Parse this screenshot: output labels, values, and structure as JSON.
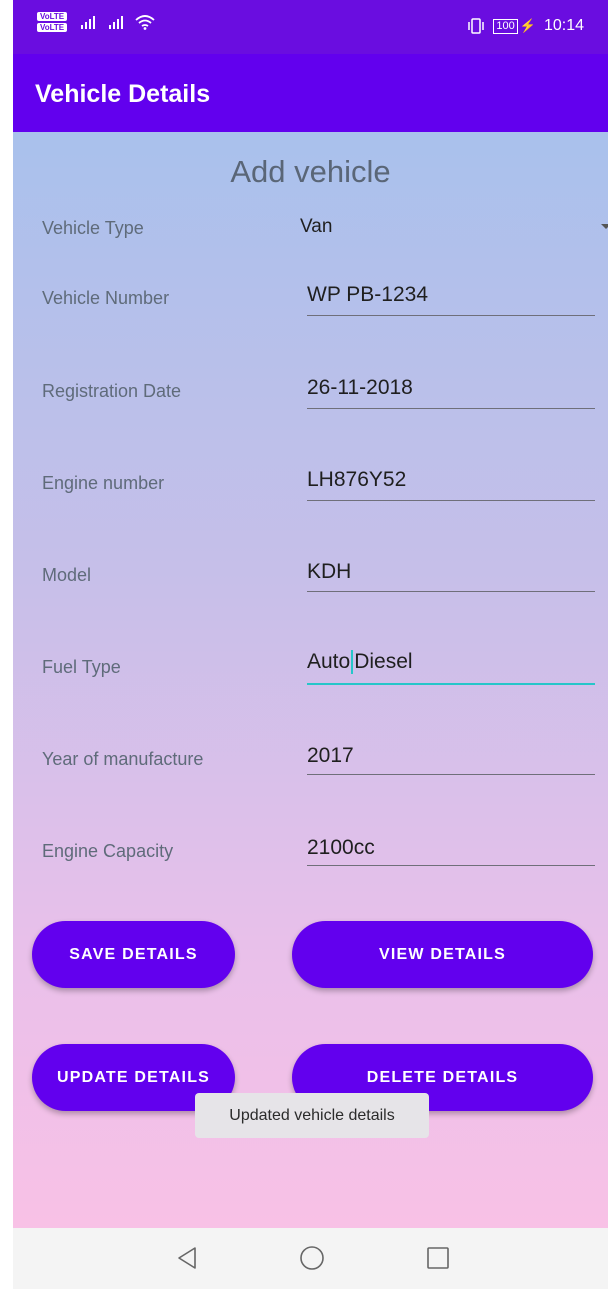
{
  "status_bar": {
    "volte_labels": [
      "VoLTE",
      "VoLTE"
    ],
    "battery_level": "100",
    "time": "10:14",
    "icons": [
      "signal-icon",
      "signal-icon",
      "wifi-icon",
      "vibrate-icon",
      "battery-icon",
      "charging-icon"
    ]
  },
  "app_bar": {
    "title": "Vehicle Details"
  },
  "form": {
    "title": "Add vehicle",
    "vehicle_type": {
      "label": "Vehicle Type",
      "value": "Van"
    },
    "vehicle_number": {
      "label": "Vehicle Number",
      "value": "WP PB-1234"
    },
    "registration_date": {
      "label": "Registration Date",
      "value": "26-11-2018"
    },
    "engine_number": {
      "label": "Engine number",
      "value": "LH876Y52"
    },
    "model": {
      "label": "Model",
      "value": "KDH"
    },
    "fuel_type": {
      "label": "Fuel Type",
      "value_before_cursor": "Auto",
      "value_after_cursor": "Diesel"
    },
    "year_of_manufacture": {
      "label": "Year of manufacture",
      "value": "2017"
    },
    "engine_capacity": {
      "label": "Engine Capacity",
      "value": "2100cc"
    }
  },
  "buttons": {
    "save": "SAVE DETAILS",
    "view": "VIEW DETAILS",
    "update": "UPDATE DETAILS",
    "delete": "DELETE DETAILS"
  },
  "toast": {
    "message": "Updated vehicle details"
  },
  "colors": {
    "primary": "#6200ee",
    "status_bar": "#6a0de0",
    "focus_accent": "#26c6c9"
  },
  "nav_bar": {
    "icons": [
      "back-icon",
      "home-icon",
      "recents-icon"
    ]
  }
}
